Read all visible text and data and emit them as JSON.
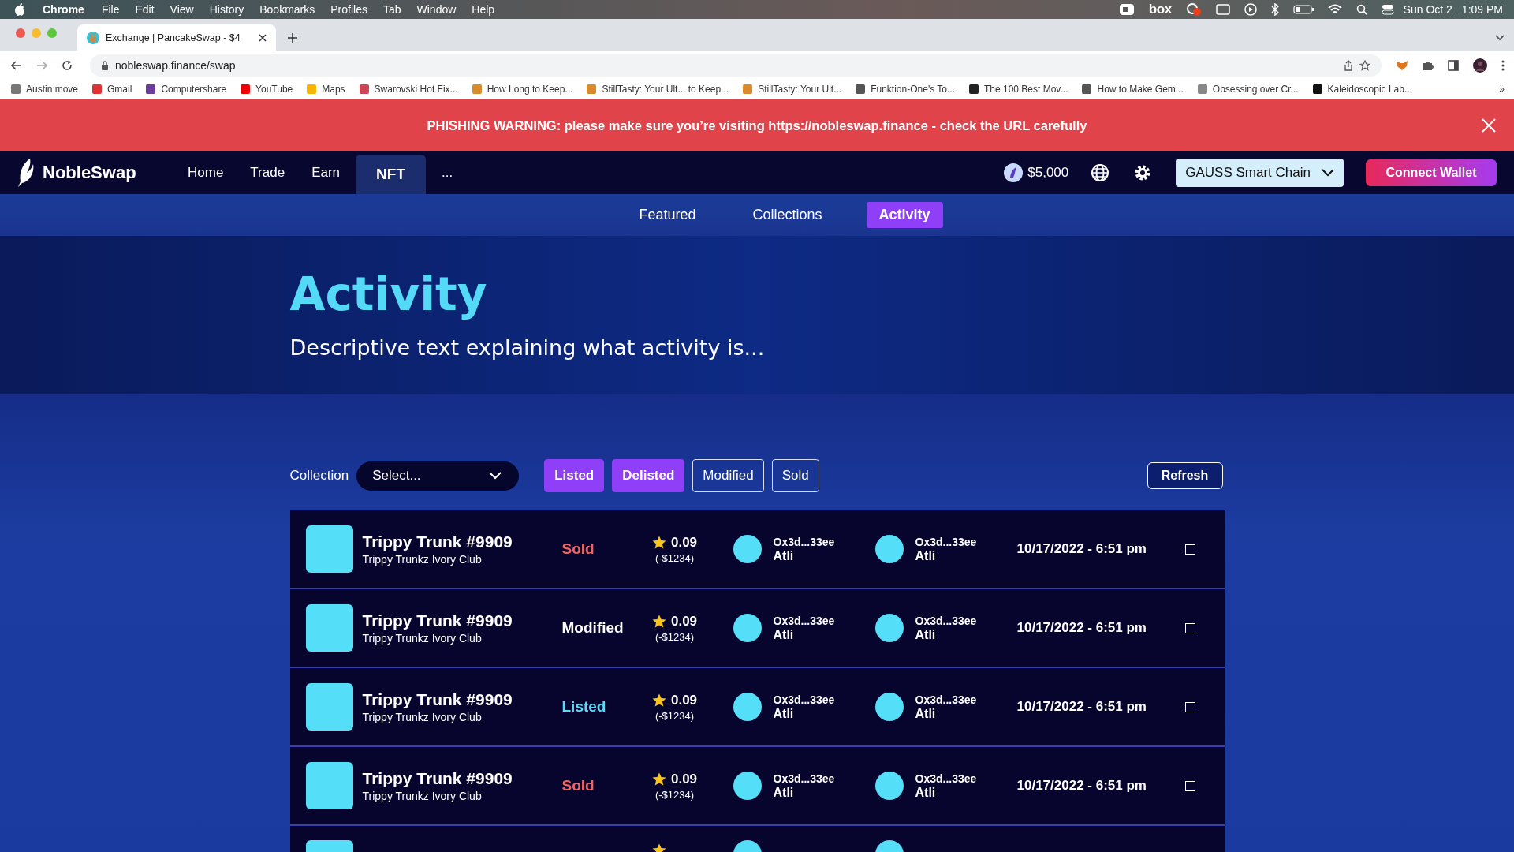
{
  "menu_bar": {
    "app": "Chrome",
    "items": [
      "File",
      "Edit",
      "View",
      "History",
      "Bookmarks",
      "Profiles",
      "Tab",
      "Window",
      "Help"
    ],
    "status_logo": "box",
    "date": "Sun Oct 2",
    "time": "1:09 PM"
  },
  "browser": {
    "tab_title": "Exchange | PancakeSwap - $4",
    "url": "nobleswap.finance/swap",
    "bookmarks": [
      "Austin move",
      "Gmail",
      "Computershare",
      "YouTube",
      "Maps",
      "Swarovski Hot Fix...",
      "How Long to Keep...",
      "StillTasty: Your Ult... to Keep...",
      "StillTasty: Your Ult...",
      "Funktion-One's To...",
      "The 100 Best Mov...",
      "How to Make Gem...",
      "Obsessing over Cr...",
      "Kaleidoscopic Lab..."
    ],
    "more": "»"
  },
  "banner": {
    "text": "PHISHING WARNING: please make sure you’re visiting https://nobleswap.finance - check the URL carefully"
  },
  "nav": {
    "logo": "NobleSwap",
    "items": [
      {
        "label": "Home",
        "selected": false
      },
      {
        "label": "Trade",
        "selected": false
      },
      {
        "label": "Earn",
        "selected": false
      },
      {
        "label": "NFT",
        "selected": true
      },
      {
        "label": "...",
        "selected": false
      }
    ],
    "price": "$5,000",
    "network": "GAUSS Smart Chain",
    "connect": "Connect Wallet"
  },
  "subnav": [
    {
      "label": "Featured",
      "selected": false
    },
    {
      "label": "Collections",
      "selected": false
    },
    {
      "label": "Activity",
      "selected": true
    }
  ],
  "hero": {
    "title": "Activity",
    "description": "Descriptive text explaining what activity is..."
  },
  "filters": {
    "label": "Collection",
    "placeholder": "Select...",
    "toggles": [
      {
        "label": "Listed",
        "selected": true
      },
      {
        "label": "Delisted",
        "selected": true
      },
      {
        "label": "Modified",
        "selected": false
      },
      {
        "label": "Sold",
        "selected": false
      }
    ],
    "refresh": "Refresh"
  },
  "rows": [
    {
      "kind": "full",
      "name": "Trippy Trunk #9909",
      "collection": "Trippy Trunkz Ivory Club",
      "status": "Sold",
      "color": "#f26363",
      "price": "0.09",
      "price_usd": "(-$1234)",
      "from_address": "Ox3d...33ee",
      "from_name": "Atli",
      "to_address": "Ox3d...33ee",
      "to_name": "Atli",
      "date": "10/17/2022 - 6:51 pm",
      "checked": false
    },
    {
      "kind": "full",
      "name": "Trippy Trunk #9909",
      "collection": "Trippy Trunkz Ivory Club",
      "status": "Modified",
      "color": "#ffffff",
      "price": "0.09",
      "price_usd": "(-$1234)",
      "from_address": "Ox3d...33ee",
      "from_name": "Atli",
      "to_address": "Ox3d...33ee",
      "to_name": "Atli",
      "date": "10/17/2022 - 6:51 pm",
      "checked": false
    },
    {
      "kind": "full",
      "name": "Trippy Trunk #9909",
      "collection": "Trippy Trunkz Ivory Club",
      "status": "Listed",
      "color": "#5bd9f7",
      "price": "0.09",
      "price_usd": "(-$1234)",
      "from_address": "Ox3d...33ee",
      "from_name": "Atli",
      "to_address": "Ox3d...33ee",
      "to_name": "Atli",
      "date": "10/17/2022 - 6:51 pm",
      "checked": false
    },
    {
      "kind": "full",
      "name": "Trippy Trunk #9909",
      "collection": "Trippy Trunkz Ivory Club",
      "status": "Sold",
      "color": "#f26363",
      "price": "0.09",
      "price_usd": "(-$1234)",
      "from_address": "Ox3d...33ee",
      "from_name": "Atli",
      "to_address": "Ox3d...33ee",
      "to_name": "Atli",
      "date": "10/17/2022 - 6:51 pm",
      "checked": false
    },
    {
      "kind": "partial"
    }
  ]
}
